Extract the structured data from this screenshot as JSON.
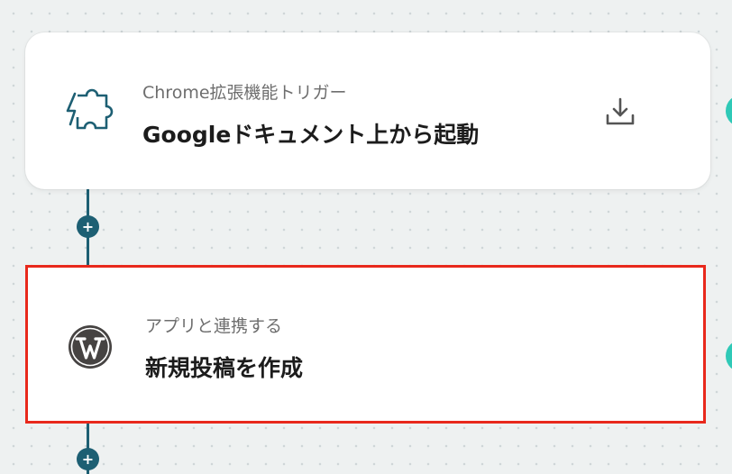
{
  "flow": {
    "steps": [
      {
        "type": "trigger",
        "subtitle": "Chrome拡張機能トリガー",
        "title": "Googleドキュメント上から起動",
        "icon": "puzzle-lightning-icon",
        "action_icon": "download-icon"
      },
      {
        "type": "action",
        "subtitle": "アプリと連携する",
        "title": "新規投稿を作成",
        "icon": "wordpress-logo-icon",
        "selected": true
      }
    ],
    "add_step_label": "+"
  },
  "colors": {
    "connector": "#1d5f73",
    "selection_border": "#e8291c",
    "status_dot": "#2fc9b7",
    "background": "#eef1f1"
  }
}
